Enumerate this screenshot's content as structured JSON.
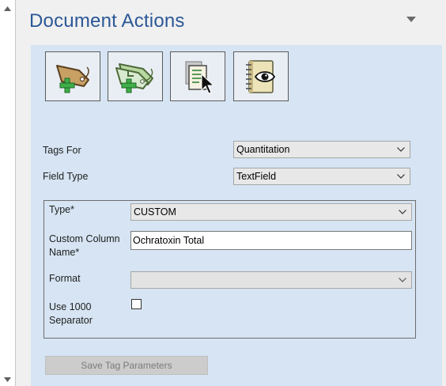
{
  "scrollbar": {
    "up_icon": "triangle-up-icon",
    "down_icon": "triangle-down-icon"
  },
  "pane": {
    "title": "Document Actions",
    "menu_icon": "dropdown-triangle-icon"
  },
  "toolbar": {
    "buttons": [
      {
        "name": "add-tag-button",
        "icon": "tag-add-icon"
      },
      {
        "name": "add-multiple-tags-button",
        "icon": "tags-add-icon"
      },
      {
        "name": "select-document-button",
        "icon": "document-cursor-icon"
      },
      {
        "name": "view-notebook-button",
        "icon": "notebook-eye-icon"
      }
    ]
  },
  "form": {
    "tags_for": {
      "label": "Tags For",
      "value": "Quantitation"
    },
    "field_type": {
      "label": "Field Type",
      "value": "TextField"
    },
    "type": {
      "label": "Type*",
      "value": "CUSTOM"
    },
    "custom_column_name": {
      "label_line1": "Custom Column",
      "label_line2": "Name*",
      "value": "Ochratoxin Total"
    },
    "format": {
      "label": "Format",
      "value": ""
    },
    "use_1000_separator": {
      "label_line1": "Use 1000",
      "label_line2": "Separator",
      "checked": false
    }
  },
  "actions": {
    "save_label": "Save Tag Parameters"
  },
  "colors": {
    "title": "#2b5797",
    "panel_background": "#d6e4f3",
    "green_plus": "#3fae49",
    "tag_tan": "#c8a064",
    "tag_green": "#b9d8a0"
  }
}
